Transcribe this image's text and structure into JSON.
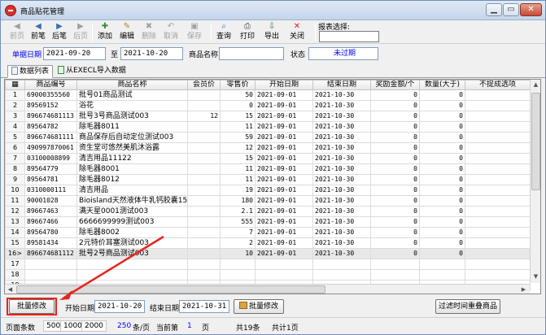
{
  "window": {
    "title": "商品贴花管理"
  },
  "toolbar": {
    "buttons": [
      {
        "label": "前页",
        "icon": "◀",
        "disabled": true
      },
      {
        "label": "前笔",
        "icon": "◀",
        "disabled": false
      },
      {
        "label": "后笔",
        "icon": "▶",
        "disabled": false
      },
      {
        "label": "后页",
        "icon": "▶",
        "disabled": true
      },
      {
        "label": "添加",
        "icon": "✚",
        "disabled": false
      },
      {
        "label": "编辑",
        "icon": "✎",
        "disabled": false
      },
      {
        "label": "删除",
        "icon": "✖",
        "disabled": true
      },
      {
        "label": "取消",
        "icon": "↶",
        "disabled": true
      },
      {
        "label": "保存",
        "icon": "▣",
        "disabled": true
      },
      {
        "label": "查询",
        "icon": "⌕",
        "disabled": false
      },
      {
        "label": "打印",
        "icon": "⎙",
        "disabled": false
      },
      {
        "label": "导出",
        "icon": "⇩",
        "disabled": false
      },
      {
        "label": "关闭",
        "icon": "✕",
        "disabled": false
      }
    ],
    "report_label": "报表选择:"
  },
  "filter": {
    "date_label": "单据日期",
    "date_from": "2021-09-20",
    "to_label": "至",
    "date_to": "2021-10-20",
    "name_label": "商品名称",
    "name_value": "",
    "status_label": "状态",
    "status_value": "未过期"
  },
  "tabs": [
    {
      "label": "数据列表",
      "active": true
    },
    {
      "label": "从EXECL导入数据",
      "active": false
    }
  ],
  "grid": {
    "columns": [
      "商品编号",
      "商品名称",
      "会员价",
      "零售价",
      "开始日期",
      "结束日期",
      "奖励金额/个",
      "数量(大于)",
      "不提成选项"
    ],
    "rows": [
      {
        "rn": "1",
        "code": "69000355560",
        "name": "批号01商品测试",
        "member": "",
        "retail": "50",
        "start": "2021-09-01",
        "end": "2021-10-30",
        "reward": "0",
        "qty": "0"
      },
      {
        "rn": "2",
        "code": "89569152",
        "name": "浴花",
        "member": "",
        "retail": "0",
        "start": "2021-09-01",
        "end": "2021-10-30",
        "reward": "0",
        "qty": "0"
      },
      {
        "rn": "3",
        "code": "896674681113",
        "name": "批号3号商品测试003",
        "member": "12",
        "retail": "15",
        "start": "2021-09-01",
        "end": "2021-10-30",
        "reward": "0",
        "qty": "0"
      },
      {
        "rn": "4",
        "code": "89564782",
        "name": "除毛器8011",
        "member": "",
        "retail": "11",
        "start": "2021-09-01",
        "end": "2021-10-30",
        "reward": "0",
        "qty": "0"
      },
      {
        "rn": "5",
        "code": "896674681111",
        "name": "商品保存后自动定位测试003",
        "member": "",
        "retail": "59",
        "start": "2021-09-01",
        "end": "2021-10-30",
        "reward": "0",
        "qty": "0"
      },
      {
        "rn": "6",
        "code": "490997870061",
        "name": "资生堂可悠然美肌沐浴露",
        "member": "",
        "retail": "12",
        "start": "2021-09-01",
        "end": "2021-10-30",
        "reward": "0",
        "qty": "0"
      },
      {
        "rn": "7",
        "code": "03100008899",
        "name": "清吉用品11122",
        "member": "",
        "retail": "15",
        "start": "2021-09-01",
        "end": "2021-10-30",
        "reward": "0",
        "qty": "0"
      },
      {
        "rn": "8",
        "code": "89564779",
        "name": "除毛器8001",
        "member": "",
        "retail": "11",
        "start": "2021-09-01",
        "end": "2021-10-30",
        "reward": "0",
        "qty": "0"
      },
      {
        "rn": "9",
        "code": "89564781",
        "name": "除毛器8012",
        "member": "",
        "retail": "11",
        "start": "2021-09-01",
        "end": "2021-10-30",
        "reward": "0",
        "qty": "0"
      },
      {
        "rn": "10",
        "code": "0310000111",
        "name": "清吉用品",
        "member": "",
        "retail": "19",
        "start": "2021-09-01",
        "end": "2021-10-30",
        "reward": "0",
        "qty": "0"
      },
      {
        "rn": "11",
        "code": "90001028",
        "name": "Bioisland天然液体牛乳钙胶囊150",
        "member": "",
        "retail": "180",
        "start": "2021-09-01",
        "end": "2021-10-30",
        "reward": "0",
        "qty": "0"
      },
      {
        "rn": "12",
        "code": "89667463",
        "name": "满天星0001测试003",
        "member": "",
        "retail": "2.1",
        "start": "2021-09-01",
        "end": "2021-10-30",
        "reward": "0",
        "qty": "0"
      },
      {
        "rn": "13",
        "code": "89667466",
        "name": "6666699999测试003",
        "member": "",
        "retail": "555",
        "start": "2021-09-01",
        "end": "2021-10-30",
        "reward": "0",
        "qty": "0"
      },
      {
        "rn": "14",
        "code": "89564780",
        "name": "除毛器8002",
        "member": "",
        "retail": "7",
        "start": "2021-09-01",
        "end": "2021-10-30",
        "reward": "0",
        "qty": "0"
      },
      {
        "rn": "15",
        "code": "89581434",
        "name": "2元特价耳塞测试003",
        "member": "",
        "retail": "2",
        "start": "2021-09-01",
        "end": "2021-10-30",
        "reward": "0",
        "qty": "0"
      },
      {
        "rn": "16>",
        "code": "896674681112",
        "name": "批号2号商品测试003",
        "member": "",
        "retail": "10",
        "start": "2021-09-01",
        "end": "2021-10-30",
        "reward": "0",
        "qty": "0",
        "current": true
      },
      {
        "rn": "17",
        "code": "",
        "name": "",
        "member": "",
        "retail": "",
        "start": "",
        "end": "",
        "reward": "",
        "qty": ""
      },
      {
        "rn": "18",
        "code": "",
        "name": "",
        "member": "",
        "retail": "",
        "start": "",
        "end": "",
        "reward": "",
        "qty": ""
      },
      {
        "rn": "19",
        "code": "",
        "name": "",
        "member": "",
        "retail": "",
        "start": "",
        "end": "",
        "reward": "",
        "qty": ""
      }
    ]
  },
  "batch": {
    "edit_label": "批量修改",
    "start_label": "开始日期",
    "start_value": "2021-10-20",
    "end_label": "结束日期",
    "end_value": "2021-10-31",
    "apply_label": "批量修改",
    "filter_expired_label": "过滤时间重叠商品"
  },
  "status": {
    "page_size_label": "页面条数",
    "sizes": [
      "500",
      "1000",
      "2000"
    ],
    "per_page": "250",
    "per_page_unit": "条/页",
    "current_label": "当前第",
    "current_page": "1",
    "page_unit": "页",
    "total_label": "共19条",
    "total_pages_label": "共计1页"
  },
  "colors": {
    "highlight": "#e8231a",
    "link": "#0000ff"
  }
}
